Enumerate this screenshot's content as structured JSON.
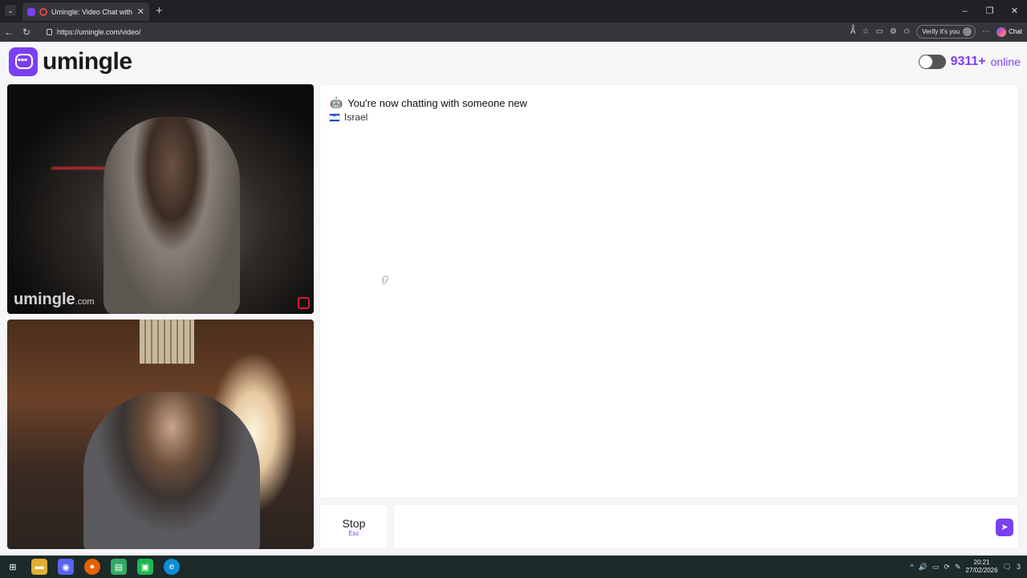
{
  "browser": {
    "tab_title": "Umingle: Video Chat with Str",
    "tab_close": "✕",
    "new_tab": "+",
    "url": "https://umingle.com/video/",
    "verify_label": "Verify it's you",
    "copilot_label": "Chat",
    "window_controls": [
      "–",
      "❐",
      "✕"
    ]
  },
  "header": {
    "logo_text": "umingle",
    "online_count": "9311",
    "online_suffix": "+",
    "online_label": "online"
  },
  "videos": {
    "remote_watermark": "umingle",
    "remote_watermark_suffix": ".com"
  },
  "chat": {
    "system_icon": "🤖",
    "system_message": "You're now chatting with someone new",
    "country": "Israel"
  },
  "controls": {
    "stop_label": "Stop",
    "stop_shortcut": "Esc",
    "message_placeholder": "",
    "send_icon": "send-icon"
  },
  "taskbar": {
    "time": "20:21",
    "date": "27/02/2026",
    "notification_count": "3"
  },
  "colors": {
    "brand": "#7b3ff2",
    "chrome_dark": "#202124",
    "taskbar": "#1c2a2a"
  }
}
